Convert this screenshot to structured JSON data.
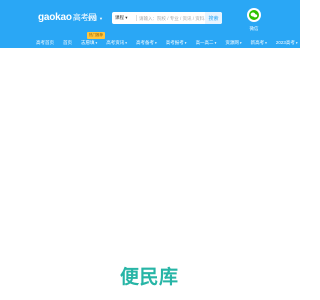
{
  "header": {
    "bg_color": "#2aa7f5",
    "logo_text": "gaokao",
    "logo_cn": "高考网",
    "region_label": "全国",
    "search": {
      "category_label": "课程",
      "placeholder": "请输入：院校 / 专业 / 资讯 / 资料..."
    },
    "search_button_label": "搜索",
    "wechat_label": "微信"
  },
  "nav": {
    "items": [
      {
        "label": "高考首页",
        "dropdown": false
      },
      {
        "label": "首页",
        "dropdown": false
      },
      {
        "label": "志愿填",
        "dropdown": true
      },
      {
        "label": "高考资讯",
        "dropdown": true
      },
      {
        "label": "高考备考",
        "dropdown": true
      },
      {
        "label": "高考报考",
        "dropdown": true
      },
      {
        "label": "高一高二",
        "dropdown": true
      },
      {
        "label": "资源网",
        "dropdown": true
      },
      {
        "label": "新高考",
        "dropdown": true
      },
      {
        "label": "2023高考",
        "dropdown": true
      }
    ],
    "badge_label": "热门推荐"
  },
  "footer": {
    "brand_text": "便民库",
    "brand_color": "#27b5a6"
  }
}
